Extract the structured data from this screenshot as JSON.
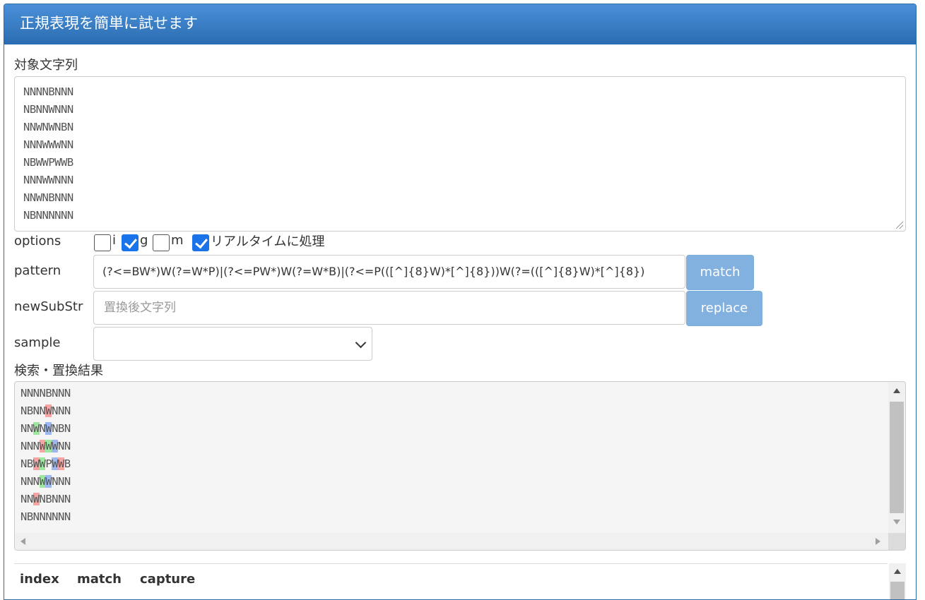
{
  "header": {
    "title": "正規表現を簡単に試せます"
  },
  "target": {
    "label": "対象文字列",
    "lines": [
      "NNNNBNNN",
      "NBNNWNNN",
      "NNWNWNBN",
      "NNNWWWNN",
      "NBWWPWWB",
      "NNNWWNNN",
      "NNWNBNNN",
      "NBNNNNNN"
    ]
  },
  "options": {
    "label": "options",
    "i": {
      "label": "i",
      "checked": false
    },
    "g": {
      "label": "g",
      "checked": true
    },
    "m": {
      "label": "m",
      "checked": false
    },
    "realtime": {
      "label": "リアルタイムに処理",
      "checked": true
    }
  },
  "pattern": {
    "label": "pattern",
    "value": "(?<=BW*)W(?=W*P)|(?<=PW*)W(?=W*B)|(?<=P(([^]{8}W)*[^]{8}))W(?=(([^]{8}W)*[^]{8})",
    "button": "match"
  },
  "newSubStr": {
    "label": "newSubStr",
    "placeholder": "置換後文字列",
    "button": "replace"
  },
  "sample": {
    "label": "sample",
    "value": ""
  },
  "result": {
    "label": "検索・置換結果",
    "lines": [
      [
        {
          "t": "NNNNBNNN"
        }
      ],
      [
        {
          "t": "NBNN"
        },
        {
          "t": "W",
          "h": "r"
        },
        {
          "t": "NNN"
        }
      ],
      [
        {
          "t": "NN"
        },
        {
          "t": "W",
          "h": "g"
        },
        {
          "t": "N"
        },
        {
          "t": "W",
          "h": "b"
        },
        {
          "t": "NBN"
        }
      ],
      [
        {
          "t": "NNN"
        },
        {
          "t": "W",
          "h": "r"
        },
        {
          "t": "W",
          "h": "g"
        },
        {
          "t": "W",
          "h": "b"
        },
        {
          "t": "NN"
        }
      ],
      [
        {
          "t": "NB"
        },
        {
          "t": "W",
          "h": "r"
        },
        {
          "t": "W",
          "h": "g"
        },
        {
          "t": "P"
        },
        {
          "t": "W",
          "h": "b"
        },
        {
          "t": "W",
          "h": "r"
        },
        {
          "t": "B"
        }
      ],
      [
        {
          "t": "NNN"
        },
        {
          "t": "W",
          "h": "g"
        },
        {
          "t": "W",
          "h": "b"
        },
        {
          "t": "NNN"
        }
      ],
      [
        {
          "t": "NN"
        },
        {
          "t": "W",
          "h": "r"
        },
        {
          "t": "NBNNN"
        }
      ],
      [
        {
          "t": "NBNNNNNN"
        }
      ]
    ]
  },
  "table": {
    "headers": [
      "index",
      "match",
      "capture"
    ]
  }
}
